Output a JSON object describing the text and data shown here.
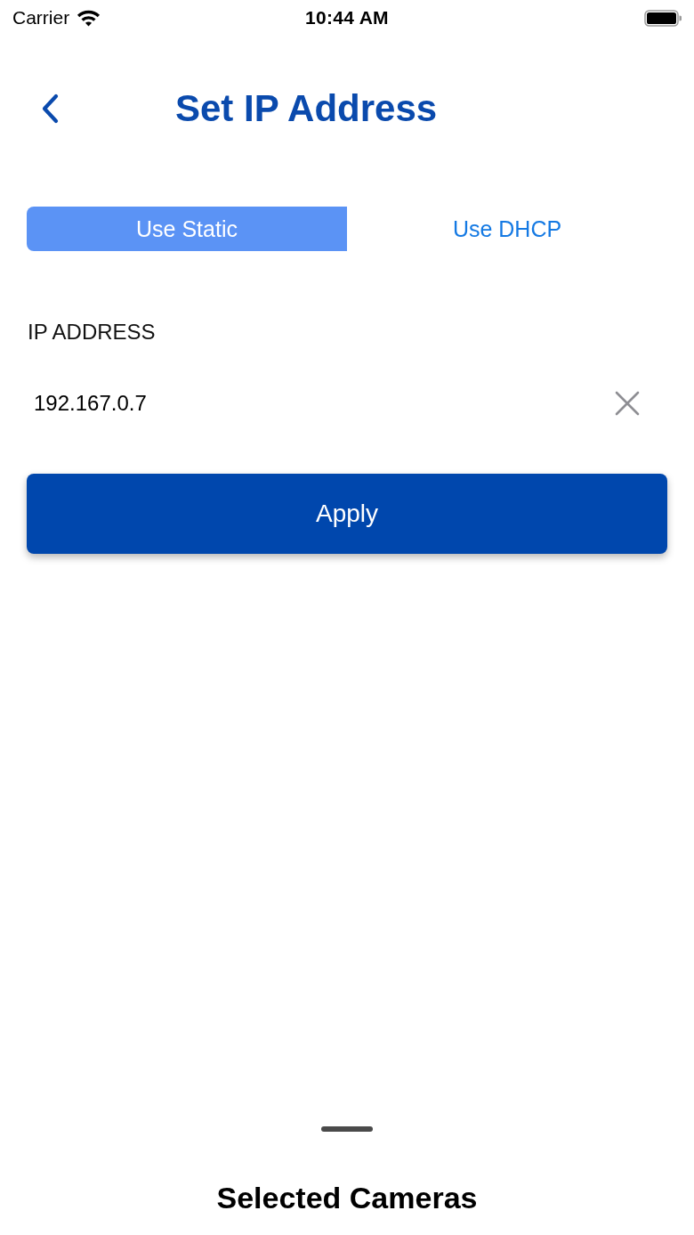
{
  "status_bar": {
    "carrier": "Carrier",
    "time": "10:44 AM"
  },
  "header": {
    "title": "Set IP Address"
  },
  "mode_tabs": [
    {
      "label": "Use Static",
      "selected": true
    },
    {
      "label": "Use DHCP",
      "selected": false
    }
  ],
  "ip_field": {
    "label": "IP ADDRESS",
    "value": "192.167.0.7"
  },
  "apply_button": {
    "label": "Apply"
  },
  "bottom_sheet": {
    "title": "Selected Cameras"
  }
}
